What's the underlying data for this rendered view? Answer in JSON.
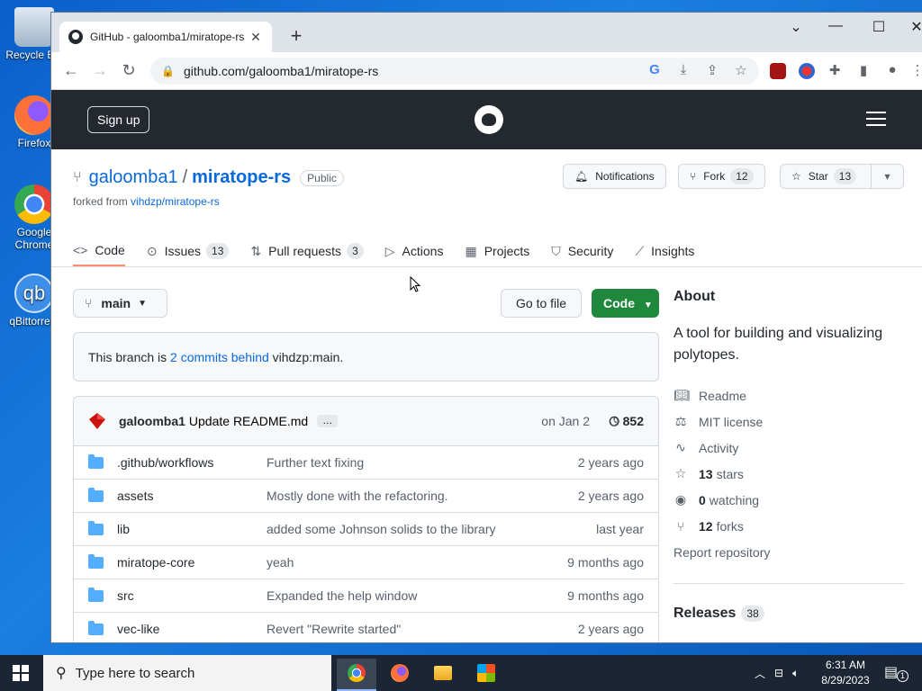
{
  "desktop": {
    "icons": [
      "Recycle Bin",
      "Firefox",
      "Google Chrome",
      "qBittorrent"
    ]
  },
  "browser": {
    "tab_title": "GitHub - galoomba1/miratope-rs",
    "url": "github.com/galoomba1/miratope-rs"
  },
  "gh_header": {
    "signup": "Sign up"
  },
  "repo": {
    "owner": "galoomba1",
    "name": "miratope-rs",
    "visibility": "Public",
    "forked_prefix": "forked from",
    "forked_from": "vihdzp/miratope-rs",
    "notifications": "Notifications",
    "fork_label": "Fork",
    "fork_count": "12",
    "star_label": "Star",
    "star_count": "13"
  },
  "nav": {
    "code": "Code",
    "issues": "Issues",
    "issues_count": "13",
    "pulls": "Pull requests",
    "pulls_count": "3",
    "actions": "Actions",
    "projects": "Projects",
    "security": "Security",
    "insights": "Insights"
  },
  "toolbar": {
    "branch": "main",
    "goto_file": "Go to file",
    "code": "Code"
  },
  "behind": {
    "prefix": "This branch is",
    "link": "2 commits behind",
    "suffix": "vihdzp:main."
  },
  "commit": {
    "author": "galoomba1",
    "message": "Update README.md",
    "dots": "…",
    "date": "on Jan 2",
    "history": "852"
  },
  "files": [
    {
      "name": ".github/workflows",
      "message": "Further text fixing",
      "age": "2 years ago"
    },
    {
      "name": "assets",
      "message": "Mostly done with the refactoring.",
      "age": "2 years ago"
    },
    {
      "name": "lib",
      "message": "added some Johnson solids to the library",
      "age": "last year"
    },
    {
      "name": "miratope-core",
      "message": "yeah",
      "age": "9 months ago"
    },
    {
      "name": "src",
      "message": "Expanded the help window",
      "age": "9 months ago"
    },
    {
      "name": "vec-like",
      "message": "Revert \"Rewrite started\"",
      "age": "2 years ago"
    }
  ],
  "about": {
    "heading": "About",
    "description": "A tool for building and visualizing polytopes.",
    "readme": "Readme",
    "license": "MIT license",
    "activity": "Activity",
    "stars_count": "13",
    "stars_label": "stars",
    "watching_count": "0",
    "watching_label": "watching",
    "forks_count": "12",
    "forks_label": "forks",
    "report": "Report repository"
  },
  "releases": {
    "heading": "Releases",
    "count": "38"
  },
  "taskbar": {
    "search_placeholder": "Type here to search",
    "time": "6:31 AM",
    "date": "8/29/2023",
    "notif_count": "1"
  }
}
